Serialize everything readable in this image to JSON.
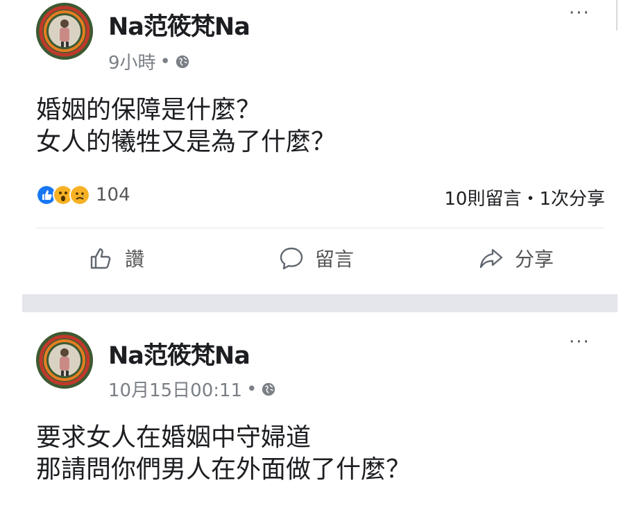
{
  "posts": [
    {
      "author": "Na范筱梵Na",
      "time": "9小時",
      "dot": "•",
      "privacy_icon": "globe-icon",
      "more": "···",
      "lines": [
        "婚姻的保障是什麼？",
        "女人的犧牲又是為了什麼？"
      ],
      "reaction_icons": [
        "like-icon",
        "wow-icon",
        "sad-icon"
      ],
      "reaction_count": "104",
      "stats": "10則留言・1次分享",
      "actions": {
        "like": "讚",
        "comment": "留言",
        "share": "分享"
      }
    },
    {
      "author": "Na范筱梵Na",
      "time": "10月15日00:11",
      "dot": "•",
      "privacy_icon": "globe-icon",
      "more": "···",
      "lines": [
        "要求女人在婚姻中守婦道",
        "那請問你們男人在外面做了什麼？"
      ]
    }
  ],
  "colors": {
    "like_blue": "#1877f2",
    "reaction_yellow": "#f7b125",
    "separator": "#e4e6eb",
    "secondary_text": "#7b7f86"
  }
}
